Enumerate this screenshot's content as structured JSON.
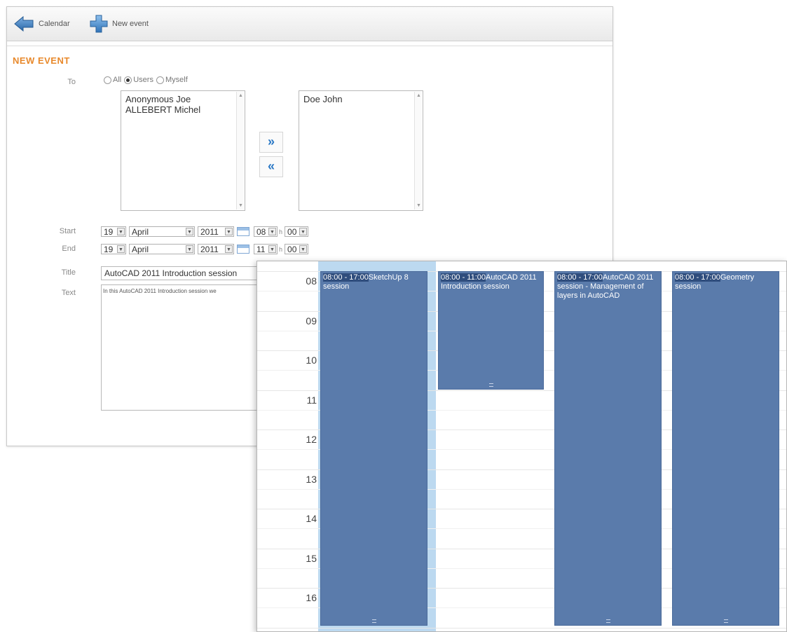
{
  "toolbar": {
    "calendar_label": "Calendar",
    "new_event_label": "New event"
  },
  "form": {
    "heading": "NEW EVENT",
    "labels": {
      "to": "To",
      "start": "Start",
      "end": "End",
      "title": "Title",
      "text": "Text"
    },
    "recipients": {
      "all": "All",
      "users": "Users",
      "myself": "Myself",
      "selected": "users"
    },
    "available_users": [
      "Anonymous Joe",
      "ALLEBERT Michel"
    ],
    "selected_users": [
      "Doe John"
    ],
    "add_label": "»",
    "remove_label": "«",
    "start": {
      "day": "19",
      "month": "April",
      "year": "2011",
      "hour": "08",
      "h_sep": "h",
      "minute": "00"
    },
    "end": {
      "day": "19",
      "month": "April",
      "year": "2011",
      "hour": "11",
      "h_sep": "h",
      "minute": "00"
    },
    "title_value": "AutoCAD 2011 Introduction session",
    "text_value": "In this AutoCAD 2011 Introduction session we"
  },
  "calendar": {
    "hours": [
      "08",
      "09",
      "10",
      "11",
      "12",
      "13",
      "14",
      "15",
      "16"
    ],
    "events": [
      {
        "time": "08:00 - 17:00",
        "title": "SketchUp 8 session",
        "color": "#5a7bab"
      },
      {
        "time": "08:00 - 11:00",
        "title": "AutoCAD 2011 Introduction session",
        "color": "#5a7bab"
      },
      {
        "time": "08:00 - 17:00",
        "title": "AutoCAD 2011 session - Management of layers in AutoCAD",
        "color": "#5a7bab"
      },
      {
        "time": "08:00 - 17:00",
        "title": "Geometry session",
        "color": "#5a7bab"
      }
    ],
    "today_column_color": "#bcd9f0"
  }
}
